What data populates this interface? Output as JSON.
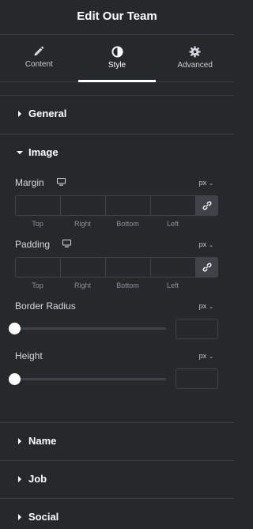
{
  "header": {
    "title": "Edit Our Team"
  },
  "tabs": [
    {
      "label": "Content",
      "icon": "pencil-icon"
    },
    {
      "label": "Style",
      "icon": "contrast-icon",
      "active": true
    },
    {
      "label": "Advanced",
      "icon": "gear-icon"
    }
  ],
  "sections": {
    "general": "General",
    "image": "Image",
    "name": "Name",
    "job": "Job",
    "social": "Social"
  },
  "image": {
    "margin": {
      "label": "Margin",
      "unit": "px",
      "dims": [
        "Top",
        "Right",
        "Bottom",
        "Left"
      ],
      "values": [
        "",
        "",
        "",
        ""
      ]
    },
    "padding": {
      "label": "Padding",
      "unit": "px",
      "dims": [
        "Top",
        "Right",
        "Bottom",
        "Left"
      ],
      "values": [
        "",
        "",
        "",
        ""
      ]
    },
    "border_radius": {
      "label": "Border Radius",
      "unit": "px",
      "value": ""
    },
    "height": {
      "label": "Height",
      "unit": "px",
      "value": ""
    }
  },
  "colors": {
    "background": "#26292c",
    "border": "#3f4347",
    "text": "#d5d8dc",
    "active": "#ffffff"
  }
}
